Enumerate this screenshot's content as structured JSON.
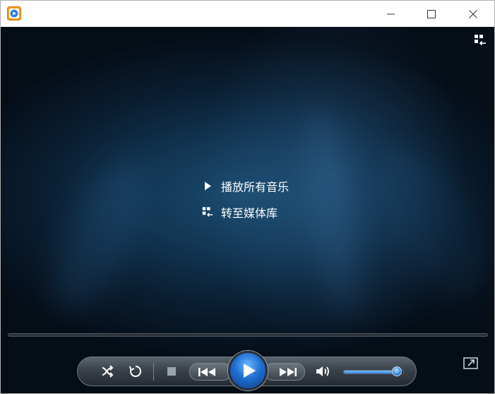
{
  "window": {
    "title": "",
    "controls": [
      "minimize-icon",
      "maximize-icon",
      "close-icon"
    ]
  },
  "stage": {
    "menu": {
      "play_all": "播放所有音乐",
      "go_to_library": "转至媒体库"
    },
    "corner_icon": "switch-to-library-icon"
  },
  "playback": {
    "volume_level": 0.88,
    "seek_position": 0,
    "accent": "#2a7fd6"
  },
  "icons": {
    "shuffle": "shuffle-icon",
    "repeat": "repeat-icon",
    "stop": "stop-icon",
    "previous": "previous-icon",
    "play": "play-icon",
    "next": "next-icon",
    "volume": "volume-icon",
    "now_playing": "switch-to-now-playing-icon"
  }
}
